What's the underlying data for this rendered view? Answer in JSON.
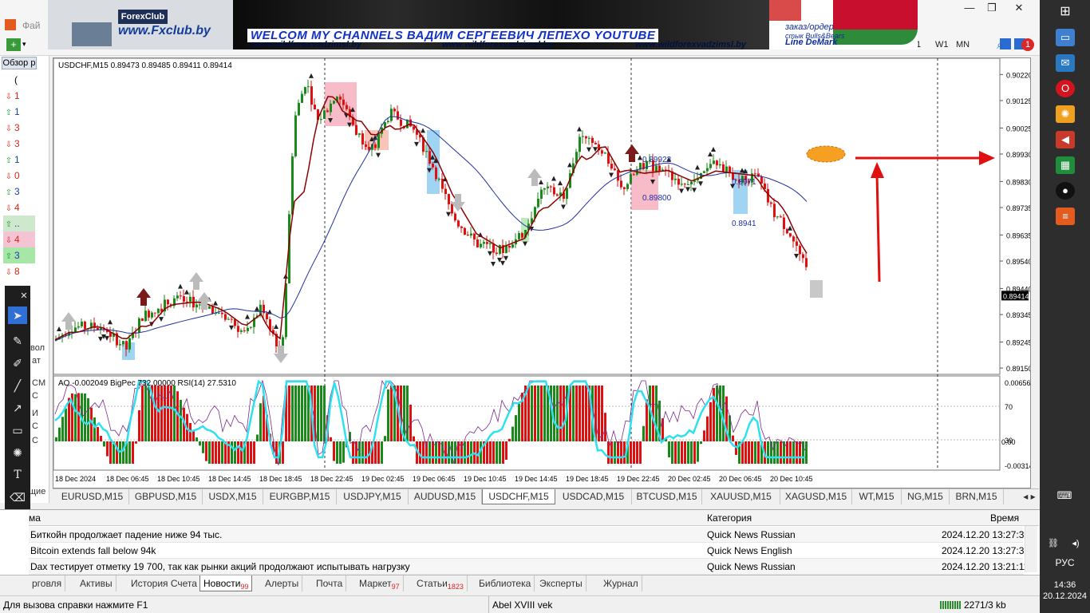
{
  "app": {
    "menu_visible": "Фай",
    "window_controls": {
      "minimize": "—",
      "restore": "❐",
      "close": "✕"
    }
  },
  "banner": {
    "logo_tag": "ForexClub",
    "logo_site": "www.Fxclub.by",
    "title": "WELCOM MY CHANNELS ВАДИМ СЕРГЕЕВИЧ ЛЕПЕХО YOUTUBE",
    "urls": [
      "www.wildforexvadzimsl.by",
      "www.wildforexvadzimsl.by",
      "www.wildforexvadzimsl.by"
    ],
    "right_line1": "заказ/ордер",
    "right_line2": "стык Bulls&Bears",
    "right_line3": "Line DeMark"
  },
  "toolbar": {
    "timeframes": [
      "1",
      "W1",
      "MN"
    ]
  },
  "navigator": {
    "title": "Обзор р",
    "rows": [
      {
        "dir": "none",
        "value": "("
      },
      {
        "dir": "dn",
        "value": "1"
      },
      {
        "dir": "up",
        "value": "1"
      },
      {
        "dir": "dn",
        "value": "3"
      },
      {
        "dir": "dn",
        "value": "3"
      },
      {
        "dir": "up",
        "value": "1"
      },
      {
        "dir": "dn",
        "value": "0"
      },
      {
        "dir": "up",
        "value": "3"
      },
      {
        "dir": "dn",
        "value": "4"
      },
      {
        "dir": "up",
        "value": ".."
      },
      {
        "dir": "dn",
        "value": "4"
      },
      {
        "dir": "up",
        "value": "3"
      },
      {
        "dir": "dn",
        "value": "8"
      }
    ],
    "lower_labels": [
      "вол",
      "ат",
      "CM",
      "C",
      "И",
      "C",
      "C",
      "щие"
    ]
  },
  "chart": {
    "header": "USDCHF,M15  0.89473 0.89485 0.89411 0.89414",
    "indicator_header": "AO -0.002049  BigPec 732.00000  RSI(14) 27.5310",
    "current_price": "0.89414",
    "price_labels": [
      "0.90220",
      "0.90125",
      "0.90025",
      "0.89930",
      "0.89830",
      "0.89735",
      "0.89635",
      "0.89540",
      "0.89440",
      "0.89345",
      "0.89245",
      "0.89150"
    ],
    "sub_labels": [
      "0.006565",
      "70",
      "30",
      "0.00",
      "-0.003142"
    ],
    "time_labels": [
      "18 Dec 2024",
      "18 Dec 06:45",
      "18 Dec 10:45",
      "18 Dec 14:45",
      "18 Dec 18:45",
      "18 Dec 22:45",
      "19 Dec 02:45",
      "19 Dec 06:45",
      "19 Dec 10:45",
      "19 Dec 14:45",
      "19 Dec 18:45",
      "19 Dec 22:45",
      "20 Dec 02:45",
      "20 Dec 06:45",
      "20 Dec 10:45"
    ],
    "annotations": [
      "0.89923",
      "0.89800",
      "0.8941",
      "0.8971"
    ],
    "colors": {
      "bull": "#1a8a1a",
      "bear": "#e01010",
      "ma_slow": "#1e2f9f",
      "ma_fast": "#8b0000",
      "rsi": "#2fe0f0",
      "arrow": "#e01010"
    }
  },
  "symbol_tabs": [
    "EURUSD,M15",
    "GBPUSD,M15",
    "USDX,M15",
    "EURGBP,M15",
    "USDJPY,M15",
    "AUDUSD,M15",
    "USDCHF,M15",
    "USDCAD,M15",
    "BTCUSD,M15",
    "XAUUSD,M15",
    "XAGUSD,M15",
    "WT,M15",
    "NG,M15",
    "BRN,M15"
  ],
  "symbol_tabs_active": "USDCHF,M15",
  "news": {
    "col_title": "ма",
    "col_category": "Категория",
    "col_time": "Время",
    "rows": [
      {
        "title": "Биткойн продолжает падение ниже 94 тыс.",
        "category": "Quick News Russian",
        "time": "2024.12.20 13:27:35"
      },
      {
        "title": "Bitcoin extends fall below 94k",
        "category": "Quick News English",
        "time": "2024.12.20 13:27:35"
      },
      {
        "title": "Dax тестирует отметку 19 700, так как рынки акций продолжают испытывать нагрузку",
        "category": "Quick News Russian",
        "time": "2024.12.20 13:21:11"
      }
    ]
  },
  "bottom_tabs": [
    {
      "label": "рговля",
      "badge": ""
    },
    {
      "label": "Активы",
      "badge": ""
    },
    {
      "label": "История Счета",
      "badge": ""
    },
    {
      "label": "Новости",
      "badge": "99"
    },
    {
      "label": "Алерты",
      "badge": ""
    },
    {
      "label": "Почта",
      "badge": ""
    },
    {
      "label": "Маркет",
      "badge": "97"
    },
    {
      "label": "Статьи",
      "badge": "1823"
    },
    {
      "label": "Библиотека",
      "badge": ""
    },
    {
      "label": "Эксперты",
      "badge": ""
    },
    {
      "label": "Журнал",
      "badge": ""
    }
  ],
  "status": {
    "help": "Для вызова справки нажмите F1",
    "profile": "Abel XVIII vek",
    "traffic": "2271/3 kb"
  },
  "taskbar": {
    "lang": "РУС",
    "time": "14:36",
    "date": "20.12.2024"
  }
}
